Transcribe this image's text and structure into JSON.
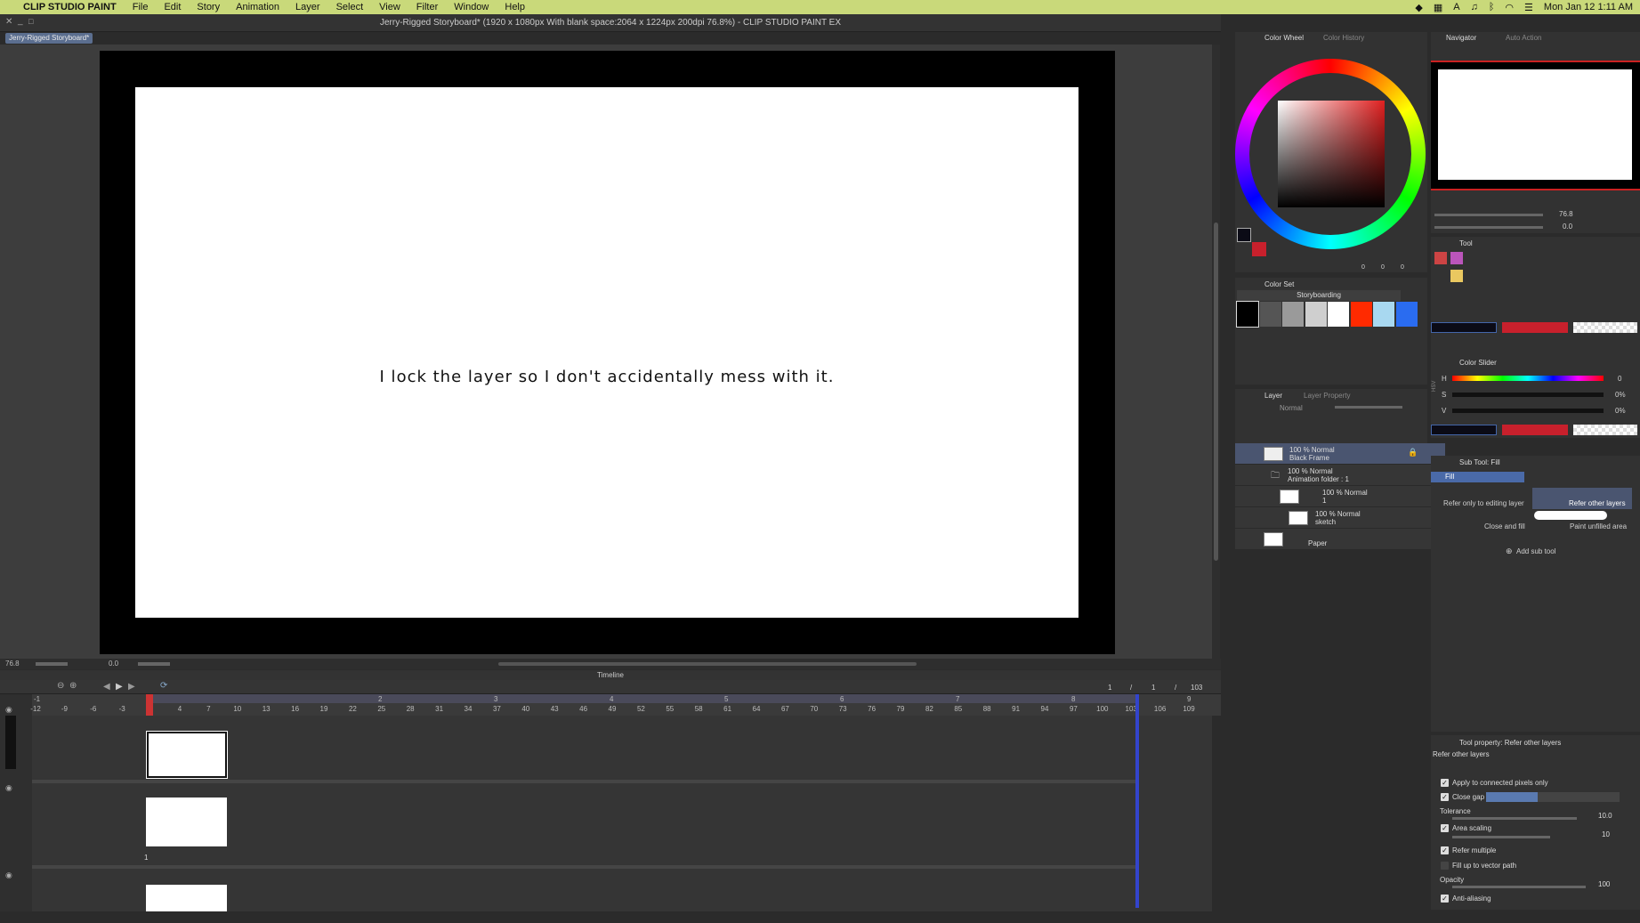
{
  "menubar": {
    "app_name": "CLIP STUDIO PAINT",
    "items": [
      "File",
      "Edit",
      "Story",
      "Animation",
      "Layer",
      "Select",
      "View",
      "Filter",
      "Window",
      "Help"
    ],
    "clock": "Mon Jan 12  1:11 AM"
  },
  "window": {
    "title": "Jerry-Rigged Storyboard* (1920 x 1080px With blank space:2064 x 1224px 200dpi 76.8%)  - CLIP STUDIO PAINT EX",
    "doc_tab": "Jerry-Rigged Storyboard*"
  },
  "canvas": {
    "caption": "I lock the layer so I don't accidentally mess with it.",
    "zoom": "76.8",
    "rotation": "0.0"
  },
  "timeline": {
    "title": "Timeline",
    "frame_current": "1",
    "frame_sep": "/",
    "frame_a": "1",
    "frame_total": "103",
    "ticks": [
      "-12",
      "-9",
      "-6",
      "-3",
      "1",
      "4",
      "7",
      "10",
      "13",
      "16",
      "19",
      "22",
      "25",
      "28",
      "31",
      "34",
      "37",
      "40",
      "43",
      "46",
      "49",
      "52",
      "55",
      "58",
      "61",
      "64",
      "67",
      "70",
      "73",
      "76",
      "79",
      "82",
      "85",
      "88",
      "91",
      "94",
      "97",
      "100",
      "103",
      "106",
      "109"
    ],
    "seconds": [
      "-1",
      "1",
      "2",
      "3",
      "4",
      "5",
      "6",
      "7",
      "8",
      "9"
    ],
    "track_label": "1"
  },
  "color_wheel": {
    "tab_active": "Color Wheel",
    "tab_other": "Color History",
    "values": [
      "0",
      "0",
      "0"
    ]
  },
  "color_set": {
    "title": "Color Set",
    "preset": "Storyboarding",
    "swatches": [
      "#000000",
      "#555555",
      "#9a9a9a",
      "#cfcfcf",
      "#ffffff",
      "#ff2a00",
      "#a8d8f0",
      "#2a6cf0"
    ]
  },
  "layer_panel": {
    "tab_active": "Layer",
    "tab_other": "Layer Property",
    "blend": "Normal",
    "layers": [
      {
        "mode": "100 % Normal",
        "name": "Black Frame"
      },
      {
        "mode": "100 % Normal",
        "name": "Animation folder : 1"
      },
      {
        "mode": "100 % Normal",
        "name": "1"
      },
      {
        "mode": "100 % Normal",
        "name": "sketch"
      },
      {
        "mode": "",
        "name": "Paper"
      }
    ]
  },
  "navigator": {
    "tab_active": "Navigator",
    "tab_other": "Auto Action",
    "zoom": "76.8",
    "rotate": "0.0"
  },
  "tool": {
    "title": "Tool"
  },
  "color_slider": {
    "title": "Color Slider",
    "rows": [
      {
        "label": "H",
        "value": "0"
      },
      {
        "label": "S",
        "value": "0%"
      },
      {
        "label": "V",
        "value": "0%"
      }
    ],
    "mode_label": "HSV"
  },
  "sub_tool": {
    "title": "Sub Tool: Fill",
    "group": "Fill",
    "items": [
      "Refer only to editing layer",
      "Refer other layers",
      "Close and fill",
      "Paint unfilled area"
    ],
    "add": "Add sub tool"
  },
  "tool_property": {
    "title": "Tool property: Refer other layers",
    "preset": "Refer other layers",
    "options": [
      {
        "label": "Apply to connected pixels only",
        "checked": true
      },
      {
        "label": "Close gap",
        "checked": true
      },
      {
        "label": "Tolerance",
        "value": "10.0"
      },
      {
        "label": "Area scaling",
        "checked": true,
        "value": "10"
      },
      {
        "label": "Refer multiple",
        "checked": true
      },
      {
        "label": "Fill up to vector path",
        "checked": false
      },
      {
        "label": "Opacity",
        "value": "100"
      },
      {
        "label": "Anti-aliasing",
        "checked": true
      }
    ]
  },
  "colors": {
    "main": "#0b0b16",
    "sub": "#c8202c",
    "accent": "#c9d97a"
  }
}
